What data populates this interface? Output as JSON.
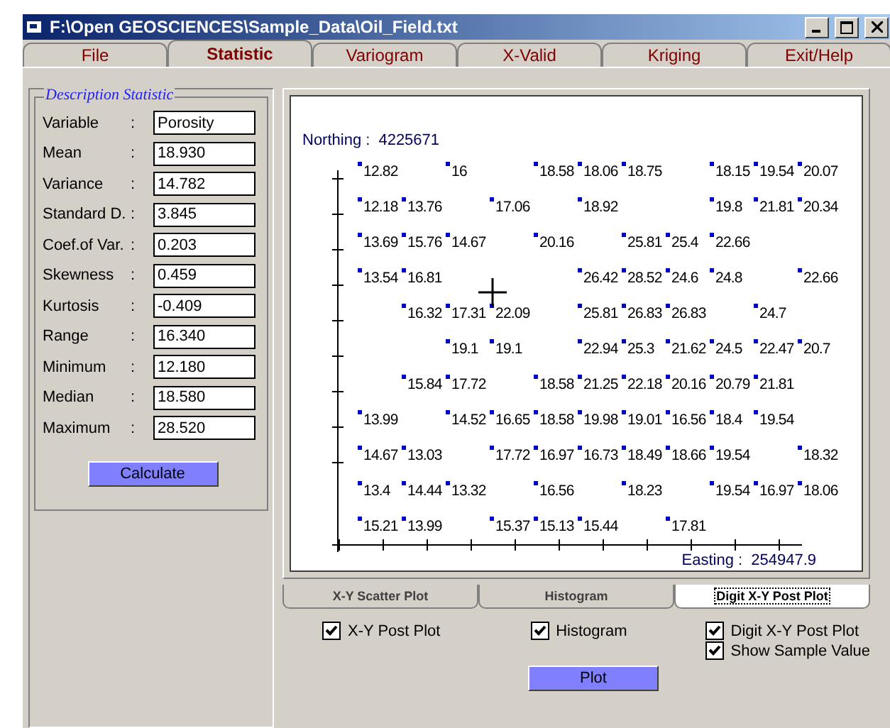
{
  "window": {
    "title": "F:\\Open GEOSCIENCES\\Sample_Data\\Oil_Field.txt"
  },
  "tabs": [
    {
      "label": "File",
      "selected": false
    },
    {
      "label": "Statistic",
      "selected": true
    },
    {
      "label": "Variogram",
      "selected": false
    },
    {
      "label": "X-Valid",
      "selected": false
    },
    {
      "label": "Kriging",
      "selected": false
    },
    {
      "label": "Exit/Help",
      "selected": false
    }
  ],
  "statistics": {
    "title": "Description Statistic",
    "rows": [
      {
        "label": "Variable",
        "colon": ":",
        "value": "Porosity"
      },
      {
        "label": "Mean",
        "colon": ":",
        "value": "18.930"
      },
      {
        "label": "Variance",
        "colon": ":",
        "value": "14.782"
      },
      {
        "label": "Standard D.",
        "colon": ":",
        "value": "3.845"
      },
      {
        "label": "Coef.of Var.",
        "colon": ":",
        "value": "0.203"
      },
      {
        "label": "Skewness",
        "colon": ":",
        "value": "0.459"
      },
      {
        "label": "Kurtosis",
        "colon": ":",
        "value": "-0.409"
      },
      {
        "label": "Range",
        "colon": ":",
        "value": "16.340"
      },
      {
        "label": "Minimum",
        "colon": ":",
        "value": "12.180"
      },
      {
        "label": "Median",
        "colon": ":",
        "value": "18.580"
      },
      {
        "label": "Maximum",
        "colon": ":",
        "value": "28.520"
      }
    ],
    "button": "Calculate"
  },
  "post_plot": {
    "northing_label": "Northing :",
    "northing": "4225671",
    "easting_label": "Easting :",
    "easting": "254947.9",
    "rows": [
      [
        "12.82",
        null,
        "16",
        null,
        "18.58",
        "18.06",
        "18.75",
        null,
        "18.15",
        "19.54",
        "20.07"
      ],
      [
        "12.18",
        "13.76",
        null,
        "17.06",
        null,
        "18.92",
        null,
        null,
        "19.8",
        "21.81",
        "20.34"
      ],
      [
        "13.69",
        "15.76",
        "14.67",
        null,
        "20.16",
        null,
        "25.81",
        "25.4",
        "22.66",
        null,
        null
      ],
      [
        "13.54",
        "16.81",
        null,
        null,
        null,
        "26.42",
        "28.52",
        "24.6",
        "24.8",
        null,
        "22.66"
      ],
      [
        null,
        "16.32",
        "17.31",
        "22.09",
        null,
        "25.81",
        "26.83",
        "26.83",
        null,
        "24.7",
        null
      ],
      [
        null,
        null,
        "19.1",
        "19.1",
        null,
        "22.94",
        "25.3",
        "21.62",
        "24.5",
        "22.47",
        "20.7"
      ],
      [
        null,
        "15.84",
        "17.72",
        null,
        "18.58",
        "21.25",
        "22.18",
        "20.16",
        "20.79",
        "21.81",
        null
      ],
      [
        "13.99",
        null,
        "14.52",
        "16.65",
        "18.58",
        "19.98",
        "19.01",
        "16.56",
        "18.4",
        "19.54",
        null
      ],
      [
        "14.67",
        "13.03",
        null,
        "17.72",
        "16.97",
        "16.73",
        "18.49",
        "18.66",
        "19.54",
        null,
        "18.32"
      ],
      [
        "13.4",
        "14.44",
        "13.32",
        null,
        "16.56",
        null,
        "18.23",
        null,
        "19.54",
        "16.97",
        "18.06"
      ],
      [
        "15.21",
        "13.99",
        null,
        "15.37",
        "15.13",
        "15.44",
        null,
        "17.81",
        null,
        null,
        null
      ]
    ]
  },
  "plot_tabs": [
    {
      "label": "X-Y Scatter Plot",
      "selected": false
    },
    {
      "label": "Histogram",
      "selected": false
    },
    {
      "label": "Digit X-Y Post Plot",
      "selected": true
    }
  ],
  "option_columns": [
    [
      {
        "label": "X-Y Post Plot",
        "checked": true
      }
    ],
    [
      {
        "label": "Histogram",
        "checked": true
      }
    ],
    [
      {
        "label": "Digit X-Y Post Plot",
        "checked": true
      },
      {
        "label": "Show Sample Value",
        "checked": true
      }
    ]
  ],
  "plot_button": "Plot"
}
